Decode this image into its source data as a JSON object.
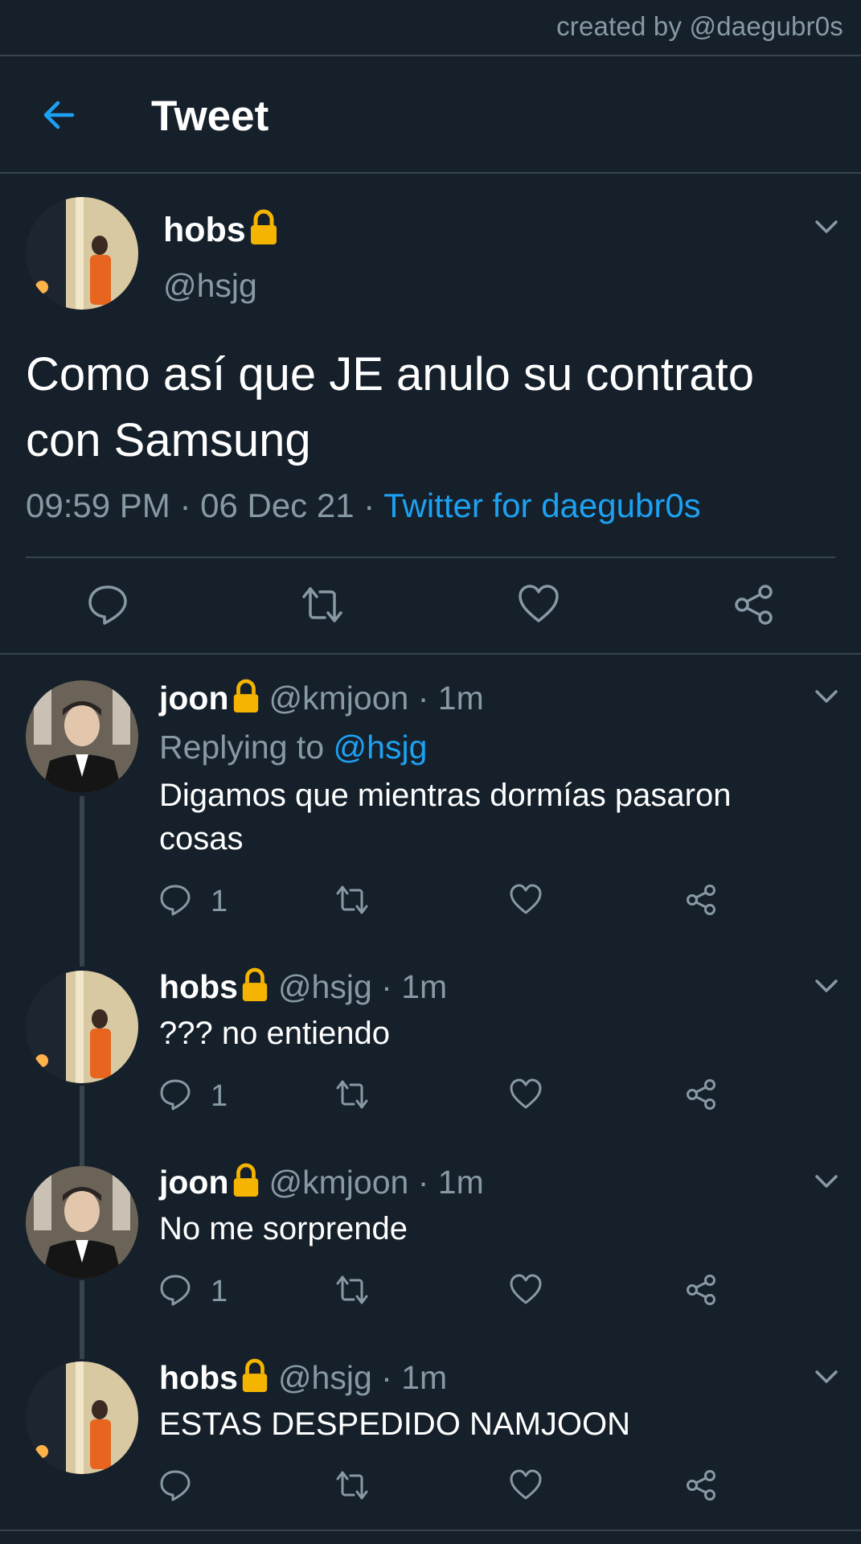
{
  "credit": "created by @daegubr0s",
  "header": {
    "title": "Tweet"
  },
  "colors": {
    "background": "#15202b",
    "accent": "#1da1f2",
    "muted": "#8899a6",
    "divider": "#38444d",
    "lock": "#f5b400"
  },
  "main_tweet": {
    "name": "hobs",
    "handle": "@hsjg",
    "text": "Como así que JE anulo su contrato con Samsung",
    "time": "09:59 PM",
    "date": "06 Dec 21",
    "source": "Twitter for daegubr0s",
    "actions": [
      "reply-icon",
      "retweet-icon",
      "like-icon",
      "share-icon"
    ]
  },
  "replies": [
    {
      "name": "joon",
      "handle": "@kmjoon",
      "time": "1m",
      "replying_label": "Replying to",
      "replying_handle": "@hsjg",
      "text": "Digamos que mientras dormías pasaron cosas",
      "reply_count": "1"
    },
    {
      "name": "hobs",
      "handle": "@hsjg",
      "time": "1m",
      "text": "??? no entiendo",
      "reply_count": "1"
    },
    {
      "name": "joon",
      "handle": "@kmjoon",
      "time": "1m",
      "text": "No me sorprende",
      "reply_count": "1"
    },
    {
      "name": "hobs",
      "handle": "@hsjg",
      "time": "1m",
      "text": "ESTAS DESPEDIDO NAMJOON",
      "reply_count": ""
    }
  ]
}
